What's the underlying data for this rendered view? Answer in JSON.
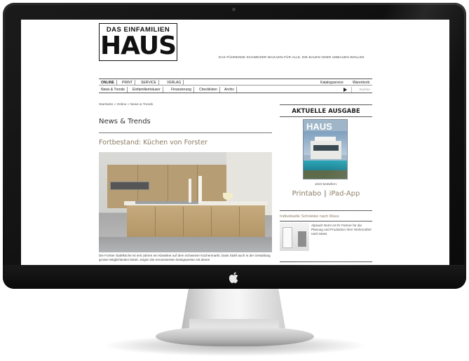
{
  "site": {
    "logo_top": "DAS EINFAMILIEN",
    "logo_main": "HAUS",
    "tagline": "DAS FÜHRENDE SCHWEIZER MAGAZIN FÜR ALLE, DIE BAUEN ODER UMBAUEN WOLLEN"
  },
  "nav": {
    "primary": [
      "ONLINE",
      "PRINT",
      "SERVICE",
      "VERLAG"
    ],
    "secondary": [
      "News & Trends",
      "Einfamilienhäuser",
      "Finanzierung",
      "Checklisten",
      "Archiv"
    ],
    "right_links": [
      "Katalogservice",
      "Warenkorb"
    ],
    "search_placeholder": "Suchen"
  },
  "content": {
    "breadcrumb": "Startseite » Online » News & Trends",
    "section_title": "News & Trends",
    "article_title": "Fortbestand: Küchen von Forster",
    "article_text": "Die Forster Stahlküche ist seit Jahren ein Klassiker auf dem Schweizer Küchenmarkt. Dass Stahl auch in der Gestaltung grosse Möglichkeiten bietet, zeigen die renommierten Designpreise mit denen"
  },
  "sidebar": {
    "issue_heading": "AKTUELLE AUSGABE",
    "cover_masthead": "HAUS",
    "cover_cta": "Jetzt bestellen:",
    "buy_links": [
      "Printabo",
      "iPad-App"
    ],
    "promo_title": "Individuelle Schränke nach Mass",
    "promo_text": "Alpnach Norm ist Ihr Partner für die Planung und Produktion Ihrer Wohnmöbel nach Mass."
  }
}
